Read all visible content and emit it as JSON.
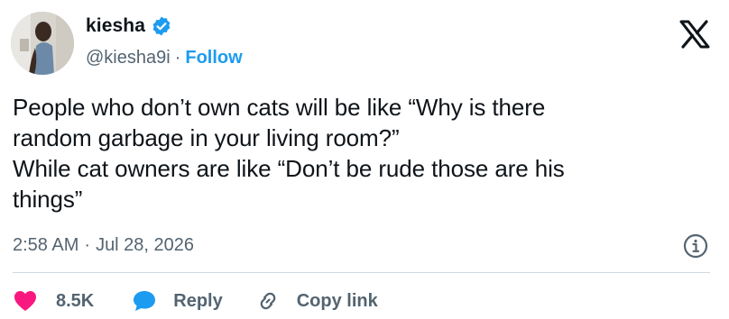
{
  "author": {
    "display_name": "kiesha",
    "handle": "@kiesha9i",
    "separator": "·",
    "follow_label": "Follow"
  },
  "tweet": {
    "text": "People who don’t own cats will be like “Why is there\nrandom garbage in your living room?”\nWhile cat owners are like “Don’t be rude those are his\nthings”",
    "time": "2:58 AM",
    "separator": "·",
    "date": "Jul 28, 2026"
  },
  "actions": {
    "like_count": "8.5K",
    "reply_label": "Reply",
    "copy_link_label": "Copy link"
  },
  "icons": {
    "verified": "verified-badge-icon",
    "brand": "x-logo-icon",
    "info": "info-icon",
    "like": "heart-icon",
    "reply": "speech-bubble-icon",
    "copy": "link-icon"
  },
  "colors": {
    "text": "#0f1419",
    "secondary": "#536471",
    "accent": "#1d9bf0",
    "like": "#f91880",
    "divider": "#cfd9de"
  }
}
